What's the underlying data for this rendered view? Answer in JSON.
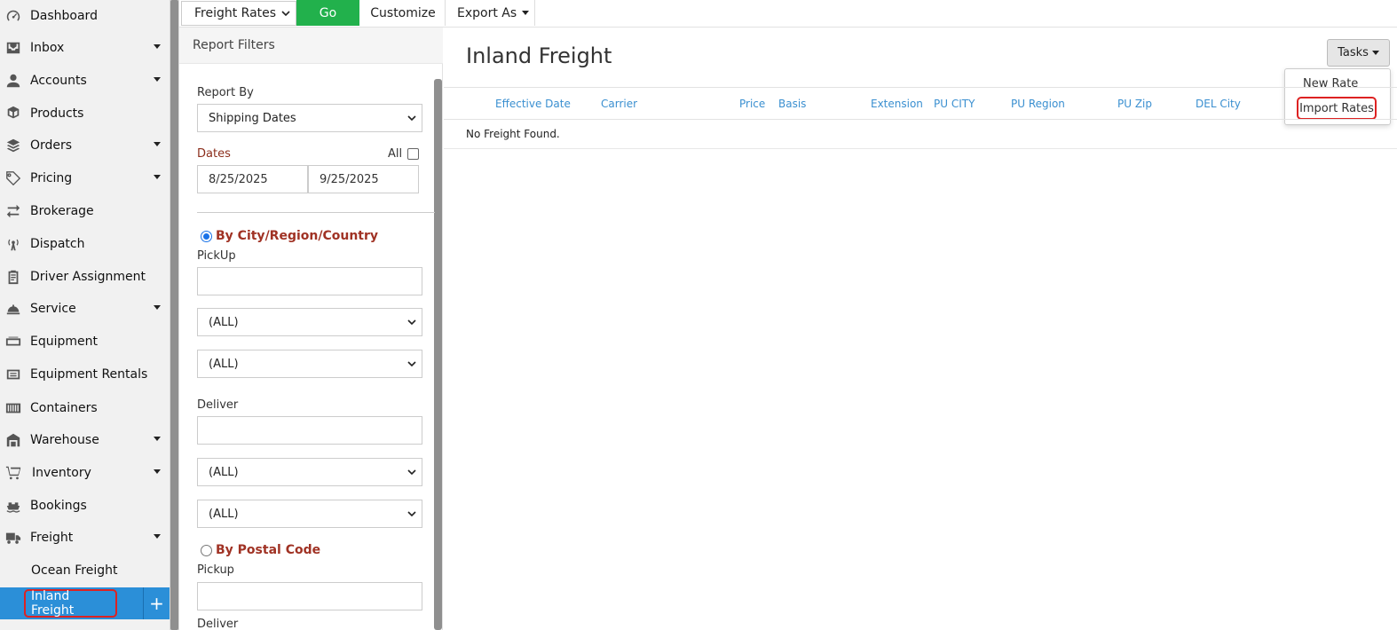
{
  "sidebar": {
    "items": [
      {
        "label": "Dashboard",
        "icon": "dashboard-icon",
        "caret": false
      },
      {
        "label": "Inbox",
        "icon": "inbox-icon",
        "caret": true
      },
      {
        "label": "Accounts",
        "icon": "user-icon",
        "caret": true
      },
      {
        "label": "Products",
        "icon": "cubes-icon",
        "caret": false
      },
      {
        "label": "Orders",
        "icon": "layers-icon",
        "caret": true
      },
      {
        "label": "Pricing",
        "icon": "tag-icon",
        "caret": true
      },
      {
        "label": "Brokerage",
        "icon": "exchange-icon",
        "caret": false
      },
      {
        "label": "Dispatch",
        "icon": "broadcast-icon",
        "caret": false
      },
      {
        "label": "Driver Assignment",
        "icon": "clipboard-icon",
        "caret": false
      },
      {
        "label": "Service",
        "icon": "bell-icon",
        "caret": true
      },
      {
        "label": "Equipment",
        "icon": "equipment-icon",
        "caret": false
      },
      {
        "label": "Equipment Rentals",
        "icon": "rental-icon",
        "caret": false
      },
      {
        "label": "Containers",
        "icon": "container-icon",
        "caret": false
      },
      {
        "label": "Warehouse",
        "icon": "warehouse-icon",
        "caret": true
      },
      {
        "label": "Inventory",
        "icon": "cart-icon",
        "caret": true
      },
      {
        "label": "Bookings",
        "icon": "ship-icon",
        "caret": false
      },
      {
        "label": "Freight",
        "icon": "truck-icon",
        "caret": true
      }
    ],
    "sub_items": {
      "ocean": "Ocean Freight",
      "inland": "Inland Freight",
      "add": "+"
    }
  },
  "toolbar": {
    "report_selected": "Freight Rates",
    "go_label": "Go",
    "customize_label": "Customize",
    "export_label": "Export As"
  },
  "filters": {
    "header": "Report Filters",
    "report_by_label": "Report By",
    "report_by_value": "Shipping Dates",
    "dates_label": "Dates",
    "all_label": "All",
    "date_from": "8/25/2025",
    "date_to": "9/25/2025",
    "by_city_label": "By City/Region/Country",
    "pickup_label": "PickUp",
    "pickup_region": "(ALL)",
    "pickup_country": "(ALL)",
    "deliver_label": "Deliver",
    "deliver_region": "(ALL)",
    "deliver_country": "(ALL)",
    "by_postal_label": "By Postal Code",
    "postal_pickup_label": "Pickup",
    "postal_deliver_label": "Deliver"
  },
  "main": {
    "title": "Inland Freight",
    "tasks_label": "Tasks",
    "tasks_menu": {
      "new_rate": "New Rate",
      "import_rates": "Import Rates"
    },
    "columns": [
      "Effective Date",
      "Carrier",
      "Price",
      "Basis",
      "Extension",
      "PU CITY",
      "PU Region",
      "PU Zip",
      "DEL City"
    ],
    "empty_message": "No Freight Found."
  },
  "colors": {
    "go_green": "#22b14c",
    "active_blue": "#2b8fd8",
    "link_blue": "#3a8fd0",
    "highlight_red": "#dd2222"
  }
}
